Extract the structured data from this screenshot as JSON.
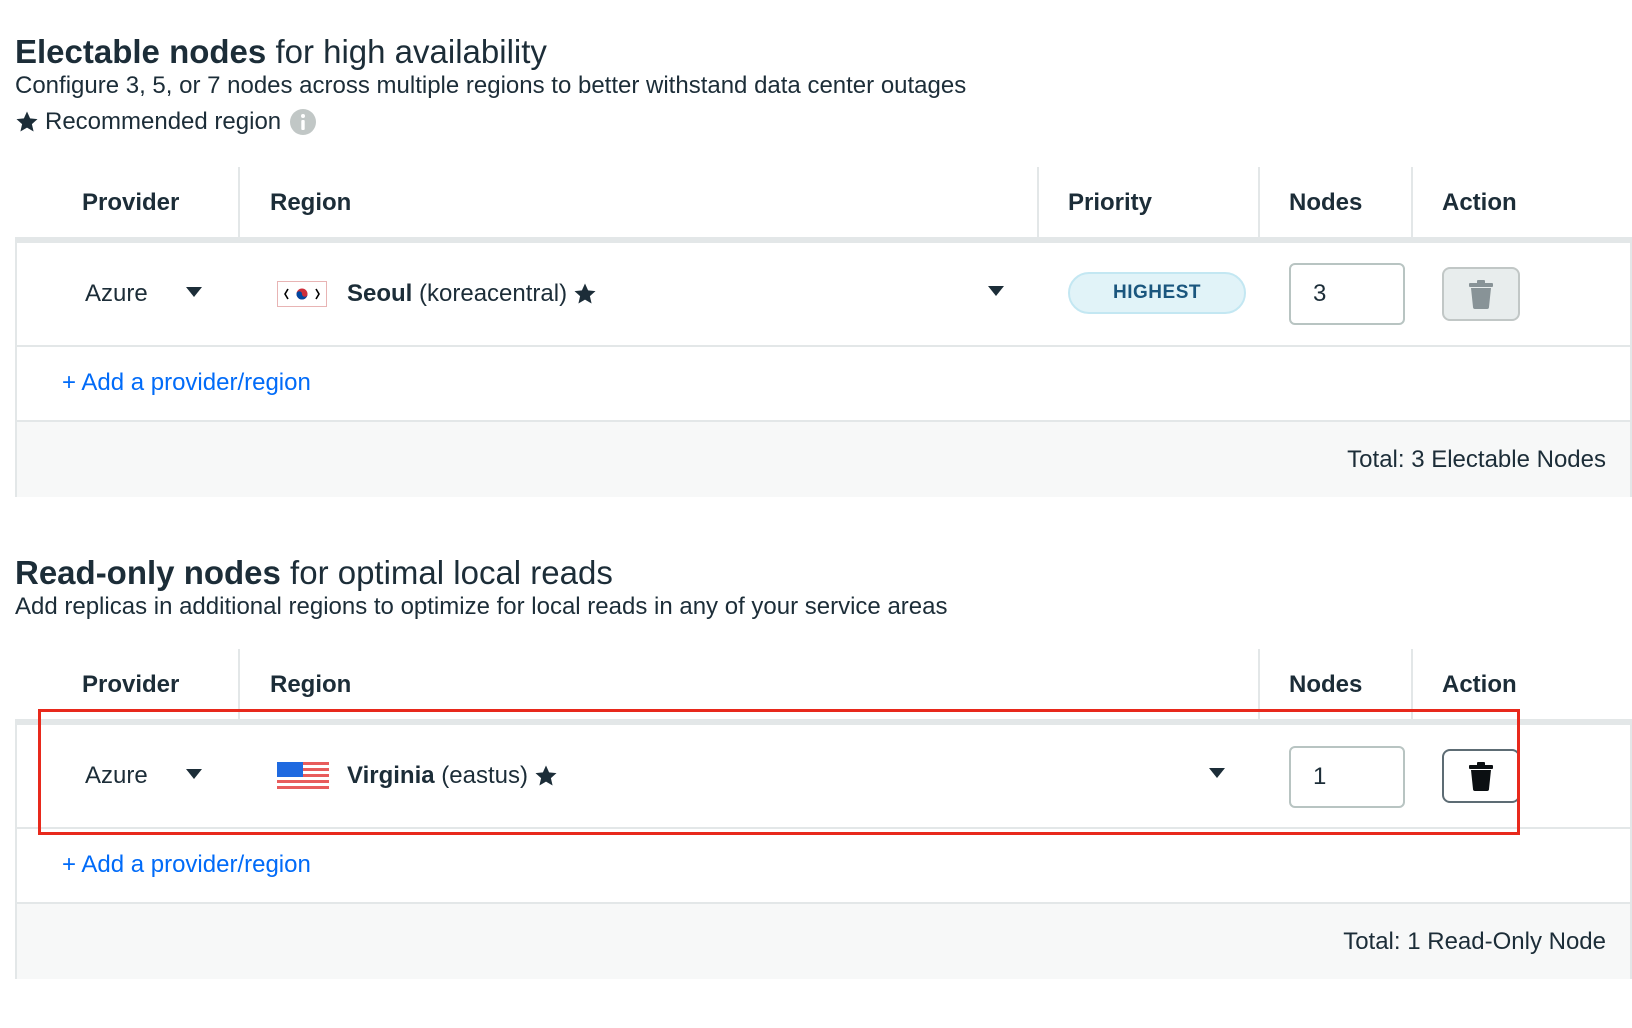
{
  "electable": {
    "title_bold": "Electable nodes",
    "title_rest": "for high availability",
    "description": "Configure 3, 5, or 7 nodes across multiple regions to better withstand data center outages",
    "legend_label": "Recommended region",
    "columns": {
      "provider": "Provider",
      "region": "Region",
      "priority": "Priority",
      "nodes": "Nodes",
      "action": "Action"
    },
    "row": {
      "provider": "Azure",
      "region_name": "Seoul",
      "region_code": "(koreacentral)",
      "flag": "south-korea-flag",
      "priority": "HIGHEST",
      "nodes": "3",
      "action_icon": "trash-icon"
    },
    "add_link": "+ Add a provider/region",
    "total": "Total: 3 Electable Nodes"
  },
  "readonly": {
    "title_bold": "Read-only nodes",
    "title_rest": "for optimal local reads",
    "description": "Add replicas in additional regions to optimize for local reads in any of your service areas",
    "columns": {
      "provider": "Provider",
      "region": "Region",
      "nodes": "Nodes",
      "action": "Action"
    },
    "row": {
      "provider": "Azure",
      "region_name": "Virginia",
      "region_code": "(eastus)",
      "flag": "usa-flag",
      "nodes": "1",
      "action_icon": "trash-icon"
    },
    "add_link": "+ Add a provider/region",
    "total": "Total: 1 Read-Only Node"
  },
  "colors": {
    "text": "#1c2d38",
    "link": "#016bf8",
    "highlight": "#e8291c",
    "badge_bg": "#e1f3f8",
    "badge_text": "#1a567e"
  }
}
